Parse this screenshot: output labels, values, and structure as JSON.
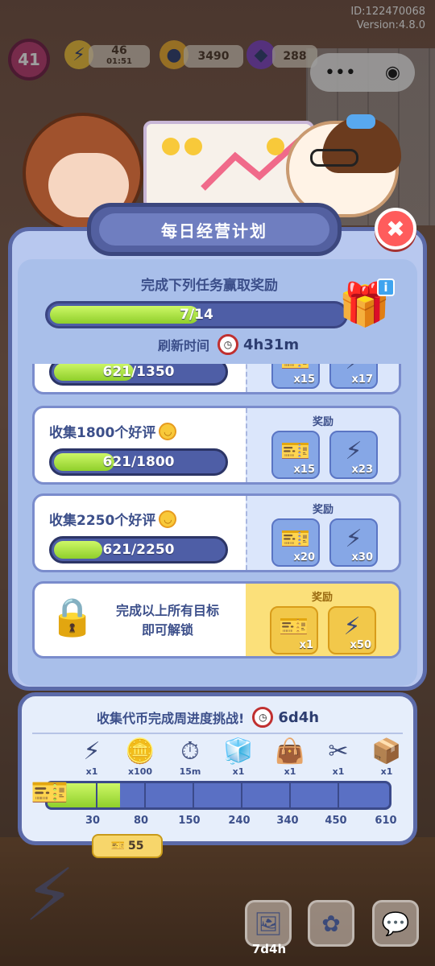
{
  "status": {
    "id_text": "ID:122470068",
    "version_text": "Version:4.8.0"
  },
  "hud": {
    "level": "41",
    "energy": "46",
    "energy_timer": "01:51",
    "coins": "3490",
    "gems": "288"
  },
  "panel": {
    "title": "每日经营计划",
    "close_glyph": "✖",
    "subtitle": "完成下列任务赢取奖励",
    "progress_text": "7/14",
    "progress_fraction": 0.5,
    "refresh_label": "刷新时间",
    "refresh_value": "4h31m",
    "info_glyph": "i"
  },
  "tasks": [
    {
      "title": "",
      "progress_text": "621/1350",
      "fraction": 0.46,
      "reward_label": "",
      "rewards": [
        {
          "icon": "ticket-icon",
          "count": "x15"
        },
        {
          "icon": "lightning-icon",
          "count": "x17"
        }
      ]
    },
    {
      "title": "收集1800个好评",
      "progress_text": "621/1800",
      "fraction": 0.345,
      "reward_label": "奖励",
      "rewards": [
        {
          "icon": "ticket-icon",
          "count": "x15"
        },
        {
          "icon": "lightning-icon",
          "count": "x23"
        }
      ]
    },
    {
      "title": "收集2250个好评",
      "progress_text": "621/2250",
      "fraction": 0.276,
      "reward_label": "奖励",
      "rewards": [
        {
          "icon": "ticket-icon",
          "count": "x20"
        },
        {
          "icon": "lightning-icon",
          "count": "x30"
        }
      ]
    }
  ],
  "final": {
    "text_line1": "完成以上所有目标",
    "text_line2": "即可解锁",
    "reward_label": "奖励",
    "rewards": [
      {
        "icon": "ticket-icon",
        "count": "x1"
      },
      {
        "icon": "lightning-icon",
        "count": "x50"
      }
    ]
  },
  "weekly": {
    "title": "收集代币完成周进度挑战!",
    "timer": "6d4h",
    "my_points": "55",
    "progress_points": 55,
    "milestones": [
      {
        "icon": "lightning-icon",
        "qty": "x1",
        "threshold": "30"
      },
      {
        "icon": "coins-icon",
        "qty": "x100",
        "threshold": "80"
      },
      {
        "icon": "stopwatch-icon",
        "qty": "15m",
        "threshold": "150"
      },
      {
        "icon": "cube-icon",
        "qty": "x1",
        "threshold": "240"
      },
      {
        "icon": "bag-icon",
        "qty": "x1",
        "threshold": "340"
      },
      {
        "icon": "scissors-icon",
        "qty": "x1",
        "threshold": "450"
      },
      {
        "icon": "box-icon",
        "qty": "x1",
        "threshold": "610"
      }
    ]
  },
  "bottom": {
    "timer_label": "7d4h"
  },
  "colors": {
    "accent": "#5b6aa8",
    "fill": "#8fcf2b",
    "reward_gold": "#fbe07a"
  }
}
